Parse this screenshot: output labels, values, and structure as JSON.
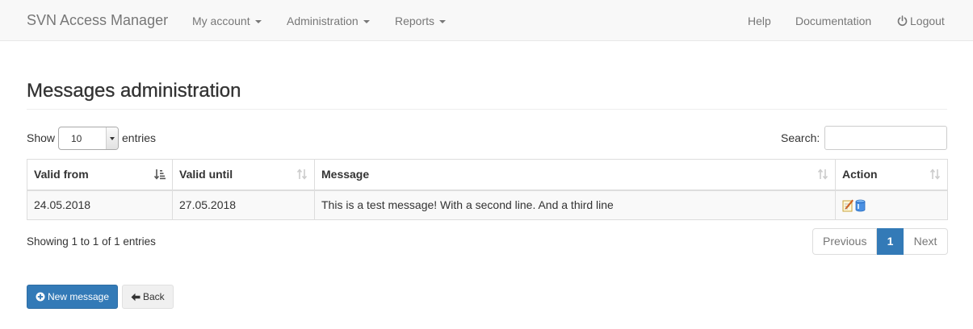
{
  "navbar": {
    "brand": "SVN Access Manager",
    "my_account": "My account",
    "administration": "Administration",
    "reports": "Reports",
    "help": "Help",
    "documentation": "Documentation",
    "logout": "Logout"
  },
  "page": {
    "title": "Messages administration"
  },
  "length": {
    "show": "Show",
    "value": "10",
    "entries": "entries"
  },
  "search": {
    "label": "Search:",
    "value": ""
  },
  "table": {
    "columns": [
      "Valid from",
      "Valid until",
      "Message",
      "Action"
    ],
    "rows": [
      {
        "valid_from": "24.05.2018",
        "valid_until": "27.05.2018",
        "message": "This is a test message! With a second line. And a third line",
        "actions": [
          "edit-icon",
          "delete-icon"
        ]
      }
    ]
  },
  "info": "Showing 1 to 1 of 1 entries",
  "pagination": {
    "previous": "Previous",
    "current": "1",
    "next": "Next"
  },
  "buttons": {
    "new_message": "New message",
    "back": "Back"
  },
  "colors": {
    "primary": "#337ab7",
    "navbar_bg": "#f8f8f8",
    "nav_text": "#777777"
  }
}
